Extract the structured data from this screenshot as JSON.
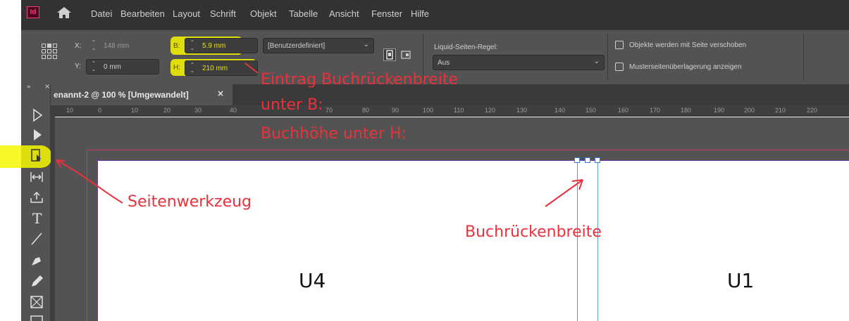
{
  "app": {
    "logo": "Id",
    "home_icon": "home-icon"
  },
  "menu": [
    "Datei",
    "Bearbeiten",
    "Layout",
    "Schrift",
    "Objekt",
    "Tabelle",
    "Ansicht",
    "Fenster",
    "Hilfe"
  ],
  "control": {
    "x_label": "X:",
    "x_value": "148 mm",
    "y_label": "Y:",
    "y_value": "0 mm",
    "b_label": "B:",
    "b_value": "5.9 mm",
    "h_label": "H:",
    "h_value": "210 mm",
    "preset_value": "[Benutzerdefiniert]",
    "liquid_label": "Liquid-Seiten-Regel:",
    "liquid_value": "Aus",
    "check1_label": "Objekte werden mit Seite verschoben",
    "check2_label": "Musterseitenüberlagerung anzeigen"
  },
  "tab": {
    "label": "enannt-2 @ 100 % [Umgewandelt]",
    "close": "×"
  },
  "ruler_ticks": [
    "10",
    "0",
    "10",
    "20",
    "30",
    "40",
    "70",
    "80",
    "90",
    "100",
    "110",
    "120",
    "130",
    "140",
    "150",
    "160",
    "170",
    "180",
    "190",
    "200",
    "210",
    "220"
  ],
  "page": {
    "left_label": "U4",
    "right_label": "U1"
  },
  "annotations": {
    "entry_line1": "Eintrag Buchrückenbreite",
    "entry_line2": "unter B:",
    "entry_line3": "Buchhöhe unter H:",
    "page_tool": "Seitenwerkzeug",
    "spine": "Buchrückenbreite"
  },
  "colors": {
    "annotation": "#e8323c",
    "highlight": "#f7f700",
    "bleed": "#d02f71",
    "spine_guide": "#5b9bd6"
  }
}
